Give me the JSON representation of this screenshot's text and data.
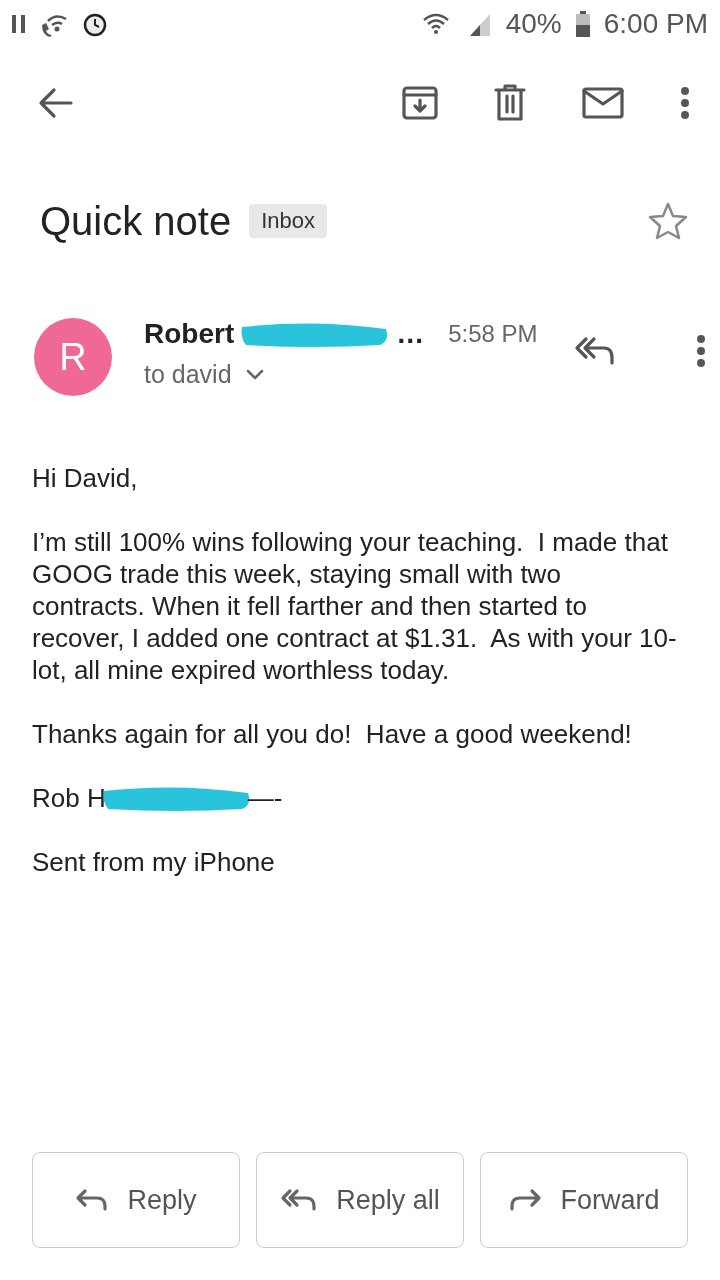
{
  "status_bar": {
    "battery": "40%",
    "time": "6:00 PM"
  },
  "subject": {
    "title": "Quick note",
    "label": "Inbox",
    "starred": false
  },
  "message": {
    "avatar_letter": "R",
    "sender": "Robert",
    "sender_end": "…",
    "time": "5:58 PM",
    "recipient": "to david"
  },
  "body": [
    "Hi David,",
    "I’m still 100% wins following your teaching.  I made that GOOG trade this week, staying small with two contracts. When it fell farther and then started to recover, I added one contract at $1.31.  As with your 10-lot, all mine expired worthless today.",
    "Thanks again for all you do!  Have a good weekend!"
  ],
  "signature": {
    "start": "Rob H",
    "end": "—-"
  },
  "footer": "Sent from my iPhone",
  "actions": [
    {
      "kind": "reply",
      "label": "Reply"
    },
    {
      "kind": "reply_all",
      "label": "Reply all"
    },
    {
      "kind": "forward",
      "label": "Forward"
    }
  ]
}
